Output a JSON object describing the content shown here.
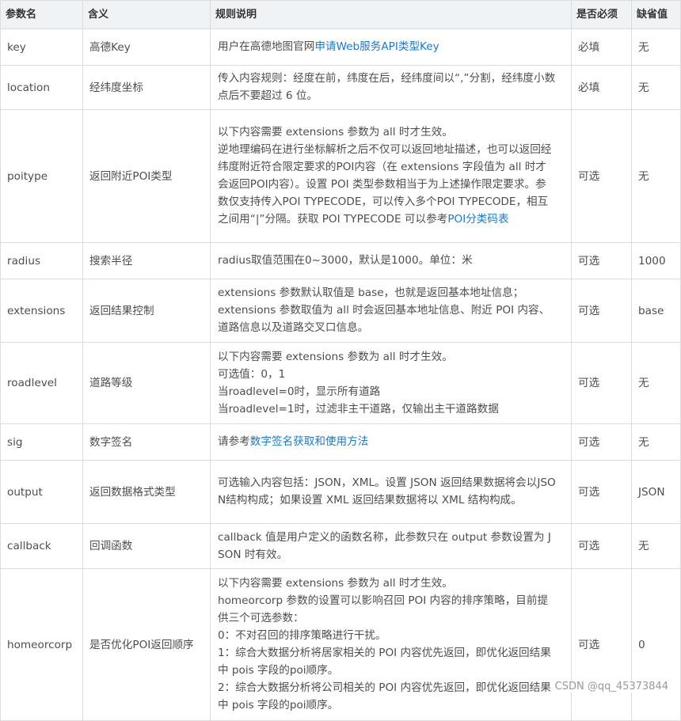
{
  "headers": [
    "参数名",
    "含义",
    "规则说明",
    "是否必须",
    "缺省值"
  ],
  "rows": [
    {
      "param": "key",
      "meaning": "高德Key",
      "desc_prefix": "用户在高德地图官网",
      "desc_link": "申请Web服务API类型Key",
      "required": "必填",
      "default": "无"
    },
    {
      "param": "location",
      "meaning": "经纬度坐标",
      "desc": "传入内容规则：经度在前，纬度在后，经纬度间以“,”分割，经纬度小数点后不要超过 6 位。",
      "required": "必填",
      "default": "无"
    },
    {
      "param": "poitype",
      "meaning": "返回附近POI类型",
      "desc_lines": [
        "以下内容需要 extensions 参数为 all 时才生效。",
        "逆地理编码在进行坐标解析之后不仅可以返回地址描述，也可以返回经纬度附近符合限定要求的POI内容（在 extensions 字段值为 all 时才会返回POI内容）。设置 POI 类型参数相当于为上述操作限定要求。参数仅支持传入POI TYPECODE，可以传入多个POI TYPECODE，相互之间用“|”分隔。获取 POI TYPECODE 可以参考"
      ],
      "desc_link": "POI分类码表",
      "required": "可选",
      "default": "无"
    },
    {
      "param": "radius",
      "meaning": "搜索半径",
      "desc": "radius取值范围在0~3000，默认是1000。单位：米",
      "required": "可选",
      "default": "1000"
    },
    {
      "param": "extensions",
      "meaning": "返回结果控制",
      "desc_lines": [
        "extensions 参数默认取值是 base，也就是返回基本地址信息；",
        "extensions 参数取值为 all 时会返回基本地址信息、附近 POI 内容、道路信息以及道路交叉口信息。"
      ],
      "required": "可选",
      "default": "base"
    },
    {
      "param": "roadlevel",
      "meaning": "道路等级",
      "desc_lines": [
        "以下内容需要 extensions 参数为 all 时才生效。",
        "可选值：0，1",
        "当roadlevel=0时，显示所有道路",
        "当roadlevel=1时，过滤非主干道路，仅输出主干道路数据"
      ],
      "required": "可选",
      "default": "无"
    },
    {
      "param": "sig",
      "meaning": "数字签名",
      "desc_prefix": "请参考",
      "desc_link": "数字签名获取和使用方法",
      "required": "可选",
      "default": "无"
    },
    {
      "param": "output",
      "meaning": "返回数据格式类型",
      "desc": "可选输入内容包括：JSON，XML。设置 JSON 返回结果数据将会以JSON结构构成；如果设置 XML 返回结果数据将以 XML 结构构成。",
      "required": "可选",
      "default": "JSON"
    },
    {
      "param": "callback",
      "meaning": "回调函数",
      "desc": "callback 值是用户定义的函数名称，此参数只在 output 参数设置为 JSON 时有效。",
      "required": "可选",
      "default": "无"
    },
    {
      "param": "homeorcorp",
      "meaning": "是否优化POI返回顺序",
      "desc_lines": [
        "以下内容需要 extensions 参数为 all 时才生效。",
        "homeorcorp 参数的设置可以影响召回 POI 内容的排序策略，目前提供三个可选参数：",
        "0：不对召回的排序策略进行干扰。",
        "1：综合大数据分析将居家相关的 POI 内容优先返回，即优化返回结果中 pois 字段的poi顺序。",
        "2：综合大数据分析将公司相关的 POI 内容优先返回，即优化返回结果中 pois 字段的poi顺序。"
      ],
      "required": "可选",
      "default": "0"
    }
  ],
  "watermark": "CSDN @qq_45373844",
  "colors": {
    "link": "#1a7ad0",
    "header_bg": "#eff3f5",
    "border": "#dddddd",
    "text": "#4d4d4d"
  }
}
